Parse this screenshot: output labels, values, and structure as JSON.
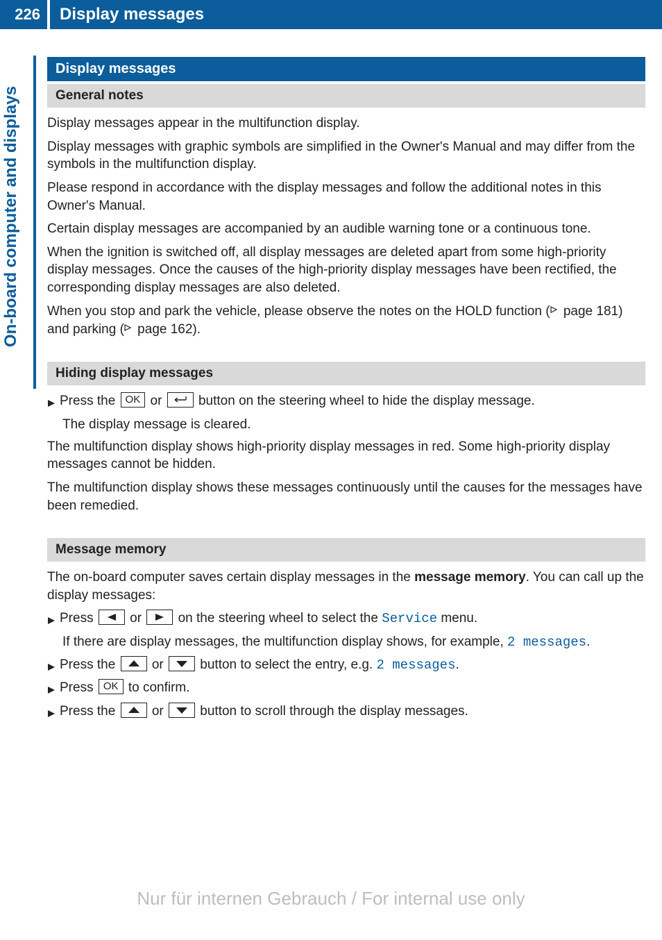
{
  "page_number": "226",
  "header_title": "Display messages",
  "side_tab": "On-board computer and displays",
  "section1": {
    "heading": "Display messages",
    "sub1": {
      "heading": "General notes",
      "p1": "Display messages appear in the multifunction display.",
      "p2": "Display messages with graphic symbols are simplified in the Owner's Manual and may differ from the symbols in the multifunction display.",
      "p3": "Please respond in accordance with the display messages and follow the additional notes in this Owner's Manual.",
      "p4": "Certain display messages are accompanied by an audible warning tone or a continuous tone.",
      "p5": "When the ignition is switched off, all display messages are deleted apart from some high-priority display messages. Once the causes of the high-priority display messages have been rectified, the corresponding display messages are also deleted.",
      "p6a": "When you stop and park the vehicle, please observe the notes on the HOLD function (",
      "p6b": " page 181) and parking (",
      "p6c": " page 162)."
    },
    "sub2": {
      "heading": "Hiding display messages",
      "step1a": "Press the ",
      "step1b": " or ",
      "step1c": " button on the steering wheel to hide the display message.",
      "step1_follow": "The display message is cleared.",
      "p1": "The multifunction display shows high-priority display messages in red. Some high-priority display messages cannot be hidden.",
      "p2": "The multifunction display shows these messages continuously until the causes for the messages have been remedied."
    },
    "sub3": {
      "heading": "Message memory",
      "intro_a": "The on-board computer saves certain display messages in the ",
      "intro_bold": "message memory",
      "intro_b": ". You can call up the display messages:",
      "step1a": "Press ",
      "step1b": " or ",
      "step1c": " on the steering wheel to select the ",
      "step1_service": "Service",
      "step1d": " menu.",
      "step1_follow_a": "If there are display messages, the multifunction display shows, for example, ",
      "step1_follow_msg": "2 messages",
      "step1_follow_b": ".",
      "step2a": "Press the ",
      "step2b": " or ",
      "step2c": " button to select the entry, e.g. ",
      "step2_msg": "2 messages",
      "step2d": ".",
      "step3a": "Press ",
      "step3b": " to confirm.",
      "step4a": "Press the ",
      "step4b": " or ",
      "step4c": " button to scroll through the display messages."
    }
  },
  "keys": {
    "ok": "OK"
  },
  "watermark": "Nur für internen Gebrauch / For internal use only"
}
